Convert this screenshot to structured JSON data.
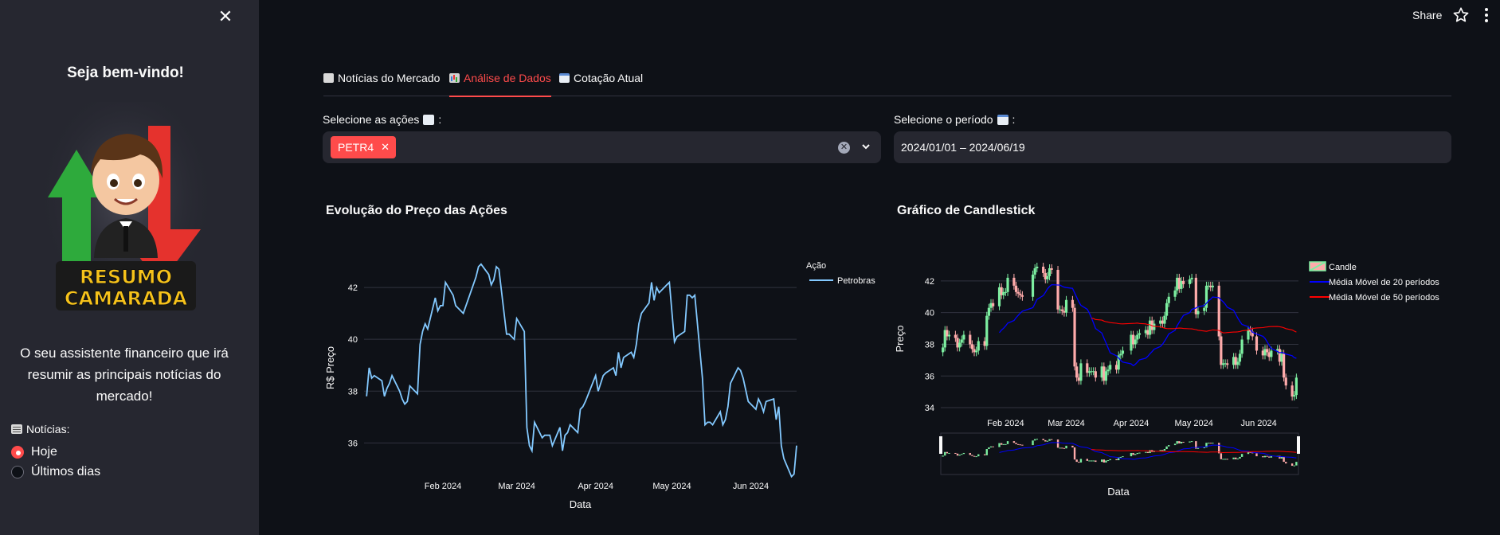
{
  "sidebar": {
    "close_glyph": "✕",
    "welcome": "Seja bem-vindo!",
    "logo_line1": "RESUMO",
    "logo_line2": "CAMARADA",
    "description": "O seu assistente financeiro que irá resumir as principais notícias do mercado!",
    "news_label": "Notícias:",
    "radio_options": [
      {
        "label": "Hoje",
        "selected": true
      },
      {
        "label": "Últimos dias",
        "selected": false
      }
    ]
  },
  "header": {
    "share": "Share"
  },
  "tabs": [
    {
      "label": "Notícias do Mercado",
      "icon": "newspaper-icon",
      "active": false
    },
    {
      "label": "Análise de Dados",
      "icon": "bar-chart-icon",
      "active": true
    },
    {
      "label": "Cotação Atual",
      "icon": "calendar-icon",
      "active": false
    }
  ],
  "stock_select": {
    "label": "Selecione as ações",
    "chips": [
      "PETR4"
    ]
  },
  "period_select": {
    "label": "Selecione o período",
    "value": "2024/01/01 – 2024/06/19"
  },
  "colors": {
    "accent": "#ff4b4b",
    "line": "#83c9ff",
    "ma20": "#0000ff",
    "ma50": "#ff0000",
    "up": "#7defa1",
    "down": "#ffabab"
  },
  "chart_data": [
    {
      "type": "line",
      "title": "Evolução do Preço das Ações",
      "xlabel": "Data",
      "ylabel": "R$ Preço",
      "legend_title": "Ação",
      "x_ticks": [
        "Feb 2024",
        "Mar 2024",
        "Apr 2024",
        "May 2024",
        "Jun 2024"
      ],
      "y_ticks": [
        36,
        38,
        40,
        42
      ],
      "ylim": [
        34.6,
        43.2
      ],
      "x_range": [
        "2024-01-01",
        "2024-06-19"
      ],
      "series": [
        {
          "name": "Petrobras",
          "x": [
            "2024-01-02",
            "2024-01-03",
            "2024-01-04",
            "2024-01-05",
            "2024-01-08",
            "2024-01-09",
            "2024-01-10",
            "2024-01-11",
            "2024-01-12",
            "2024-01-15",
            "2024-01-16",
            "2024-01-17",
            "2024-01-18",
            "2024-01-19",
            "2024-01-22",
            "2024-01-23",
            "2024-01-24",
            "2024-01-25",
            "2024-01-26",
            "2024-01-29",
            "2024-01-30",
            "2024-01-31",
            "2024-02-01",
            "2024-02-02",
            "2024-02-05",
            "2024-02-06",
            "2024-02-07",
            "2024-02-08",
            "2024-02-09",
            "2024-02-14",
            "2024-02-15",
            "2024-02-16",
            "2024-02-19",
            "2024-02-20",
            "2024-02-21",
            "2024-02-22",
            "2024-02-23",
            "2024-02-26",
            "2024-02-27",
            "2024-02-28",
            "2024-02-29",
            "2024-03-01",
            "2024-03-04",
            "2024-03-05",
            "2024-03-06",
            "2024-03-07",
            "2024-03-08",
            "2024-03-11",
            "2024-03-12",
            "2024-03-13",
            "2024-03-14",
            "2024-03-15",
            "2024-03-18",
            "2024-03-19",
            "2024-03-20",
            "2024-03-21",
            "2024-03-22",
            "2024-03-25",
            "2024-03-26",
            "2024-03-27",
            "2024-03-28",
            "2024-04-01",
            "2024-04-02",
            "2024-04-03",
            "2024-04-04",
            "2024-04-05",
            "2024-04-08",
            "2024-04-09",
            "2024-04-10",
            "2024-04-11",
            "2024-04-12",
            "2024-04-15",
            "2024-04-16",
            "2024-04-17",
            "2024-04-18",
            "2024-04-19",
            "2024-04-22",
            "2024-04-23",
            "2024-04-24",
            "2024-04-25",
            "2024-04-26",
            "2024-04-29",
            "2024-04-30",
            "2024-05-02",
            "2024-05-03",
            "2024-05-06",
            "2024-05-07",
            "2024-05-08",
            "2024-05-09",
            "2024-05-10",
            "2024-05-13",
            "2024-05-14",
            "2024-05-15",
            "2024-05-16",
            "2024-05-17",
            "2024-05-20",
            "2024-05-21",
            "2024-05-22",
            "2024-05-23",
            "2024-05-24",
            "2024-05-27",
            "2024-05-28",
            "2024-05-29",
            "2024-05-31",
            "2024-06-03",
            "2024-06-04",
            "2024-06-05",
            "2024-06-06",
            "2024-06-07",
            "2024-06-10",
            "2024-06-11",
            "2024-06-12",
            "2024-06-13",
            "2024-06-14",
            "2024-06-17",
            "2024-06-18",
            "2024-06-19"
          ],
          "values": [
            37.8,
            38.9,
            38.5,
            38.6,
            38.4,
            37.8,
            38.1,
            38.3,
            38.6,
            38.0,
            37.7,
            37.5,
            37.6,
            38.2,
            37.9,
            39.8,
            40.3,
            40.6,
            40.4,
            41.6,
            41.1,
            41.3,
            41.3,
            42.2,
            41.7,
            41.3,
            41.2,
            41.1,
            41.0,
            42.4,
            42.8,
            42.9,
            42.5,
            42.1,
            42.3,
            42.8,
            42.7,
            40.2,
            40.2,
            40.1,
            40.0,
            40.8,
            40.3,
            36.6,
            35.9,
            35.7,
            36.8,
            36.2,
            36.3,
            36.3,
            36.3,
            35.9,
            36.6,
            35.7,
            36.3,
            36.4,
            36.7,
            36.4,
            37.3,
            37.4,
            37.6,
            38.6,
            38.0,
            38.3,
            38.6,
            38.7,
            38.9,
            38.6,
            39.5,
            38.9,
            39.3,
            39.5,
            39.3,
            39.8,
            40.6,
            41.0,
            41.4,
            42.2,
            41.5,
            42.0,
            41.8,
            42.1,
            42.2,
            39.9,
            40.1,
            40.3,
            41.7,
            41.7,
            41.6,
            41.7,
            38.5,
            36.7,
            36.8,
            36.8,
            36.7,
            37.2,
            36.7,
            36.9,
            37.4,
            38.3,
            38.9,
            38.8,
            38.5,
            37.6,
            37.3,
            37.7,
            37.5,
            37.2,
            37.6,
            37.7,
            36.9,
            37.4,
            35.9,
            35.4,
            34.7,
            34.8,
            35.9
          ]
        }
      ]
    },
    {
      "type": "candlestick",
      "title": "Gráfico de Candlestick",
      "xlabel": "Data",
      "ylabel": "Preço",
      "x_ticks": [
        "Feb 2024",
        "Mar 2024",
        "Apr 2024",
        "May 2024",
        "Jun 2024"
      ],
      "y_ticks": [
        34,
        36,
        38,
        40,
        42
      ],
      "ylim": [
        33.5,
        43.2
      ],
      "legend": [
        "Candle",
        "Média Móvel de 20 períodos",
        "Média Móvel de 50 períodos"
      ],
      "legend_position": "right"
    }
  ]
}
